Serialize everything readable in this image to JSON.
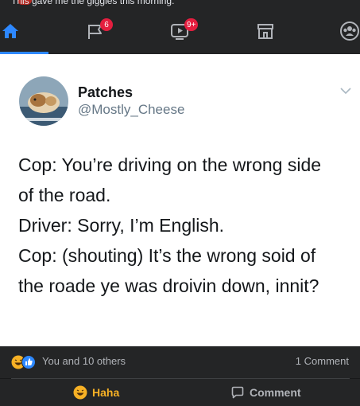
{
  "top_caption": "This gave me the giggles this morning:",
  "nav": {
    "tabs": [
      {
        "name": "home",
        "icon": "home-icon",
        "active": true
      },
      {
        "name": "pages",
        "icon": "flag-icon",
        "badge": "6"
      },
      {
        "name": "watch",
        "icon": "video-icon",
        "badge": "9+"
      },
      {
        "name": "marketplace",
        "icon": "store-icon"
      },
      {
        "name": "groups",
        "icon": "groups-icon"
      }
    ],
    "active_color": "#2d88ff",
    "badge_color": "#e41e3f"
  },
  "tweet": {
    "name": "Patches",
    "handle": "@Mostly_Cheese",
    "lines": [
      "Cop: You’re driving on the wrong side",
      "of the road.",
      "Driver: Sorry, I’m English.",
      "Cop: (shouting) It’s the wrong soid of",
      "the roade ye was droivin down, innit?"
    ]
  },
  "stats": {
    "reactions_text": "You and 10 others",
    "comments_text": "1 Comment"
  },
  "actions": {
    "haha_label": "Haha",
    "haha_color": "#f7b125",
    "comment_label": "Comment"
  }
}
